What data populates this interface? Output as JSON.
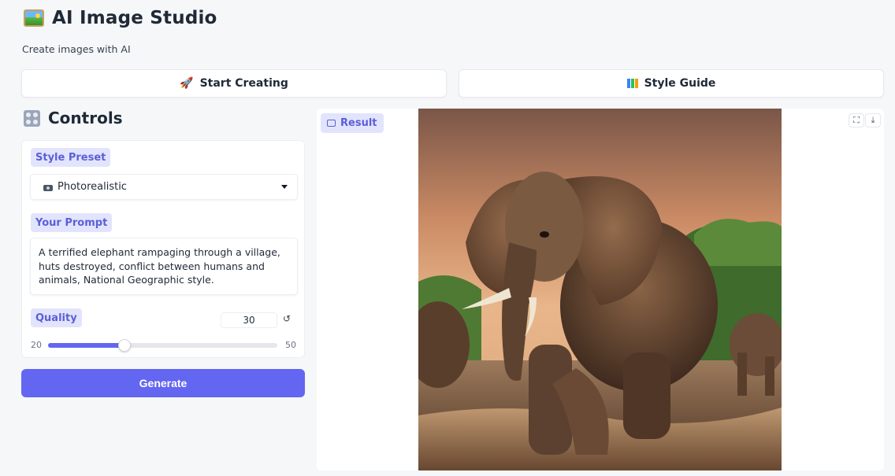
{
  "app": {
    "title": "AI Image Studio",
    "subtitle": "Create images with AI",
    "logo_icon": "framed-picture-icon"
  },
  "tabs": [
    {
      "label": "Start Creating",
      "icon": "rocket-icon"
    },
    {
      "label": "Style Guide",
      "icon": "books-icon"
    }
  ],
  "controls": {
    "title": "Controls",
    "icon": "control-knobs-icon",
    "style_preset": {
      "label": "Style Preset",
      "value": "Photorealistic",
      "icon": "camera-icon"
    },
    "prompt": {
      "label": "Your Prompt",
      "value": "A terrified elephant rampaging through a village, huts destroyed, conflict between humans and animals, National Geographic style."
    },
    "quality": {
      "label": "Quality",
      "value": "30",
      "min": "20",
      "max": "50",
      "reset_symbol": "↺"
    },
    "generate_label": "Generate"
  },
  "result": {
    "label": "Result",
    "fullscreen_symbol": "⛶",
    "download_symbol": "⤓"
  },
  "colors": {
    "accent": "#6366f1",
    "chip_bg": "#e2e4fd",
    "chip_text": "#5b5fd6",
    "page_bg": "#f6f7f9"
  }
}
